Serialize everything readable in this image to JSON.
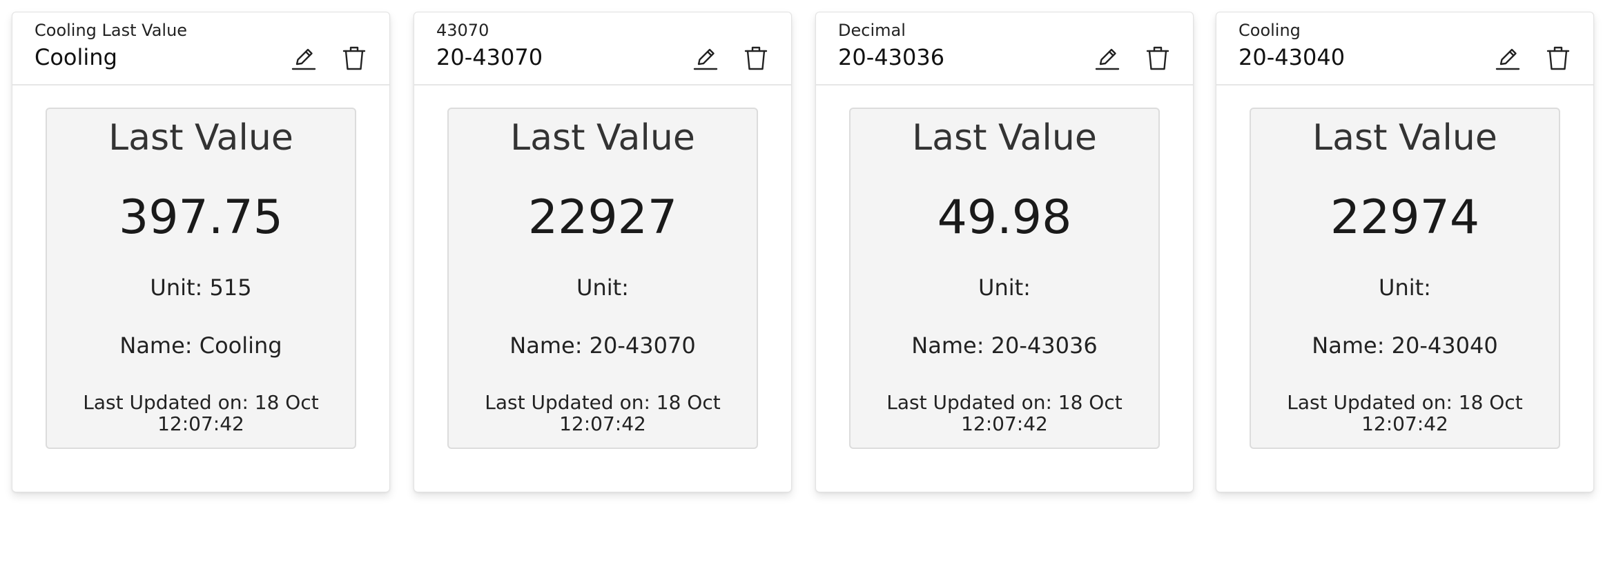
{
  "colors": {
    "card_border": "#e2e2e2",
    "box_background": "#f4f4f4",
    "box_border": "#dcdcdc",
    "text": "#222222"
  },
  "cards": [
    {
      "subtitle": "Cooling Last Value",
      "title": "Cooling",
      "edit_icon": "pencil-icon",
      "delete_icon": "trash-icon",
      "heading": "Last Value",
      "value": "397.75",
      "unit_text": "Unit: 515",
      "name_text": "Name: Cooling",
      "updated_line1": "Last Updated on: 18 Oct",
      "updated_line2": "12:07:42"
    },
    {
      "subtitle": "43070",
      "title": "20-43070",
      "edit_icon": "pencil-icon",
      "delete_icon": "trash-icon",
      "heading": "Last Value",
      "value": "22927",
      "unit_text": "Unit:",
      "name_text": "Name: 20-43070",
      "updated_line1": "Last Updated on: 18 Oct",
      "updated_line2": "12:07:42"
    },
    {
      "subtitle": "Decimal",
      "title": "20-43036",
      "edit_icon": "pencil-icon",
      "delete_icon": "trash-icon",
      "heading": "Last Value",
      "value": "49.98",
      "unit_text": "Unit:",
      "name_text": "Name: 20-43036",
      "updated_line1": "Last Updated on: 18 Oct",
      "updated_line2": "12:07:42"
    },
    {
      "subtitle": "Cooling",
      "title": "20-43040",
      "edit_icon": "pencil-icon",
      "delete_icon": "trash-icon",
      "heading": "Last Value",
      "value": "22974",
      "unit_text": "Unit:",
      "name_text": "Name: 20-43040",
      "updated_line1": "Last Updated on: 18 Oct",
      "updated_line2": "12:07:42"
    }
  ]
}
